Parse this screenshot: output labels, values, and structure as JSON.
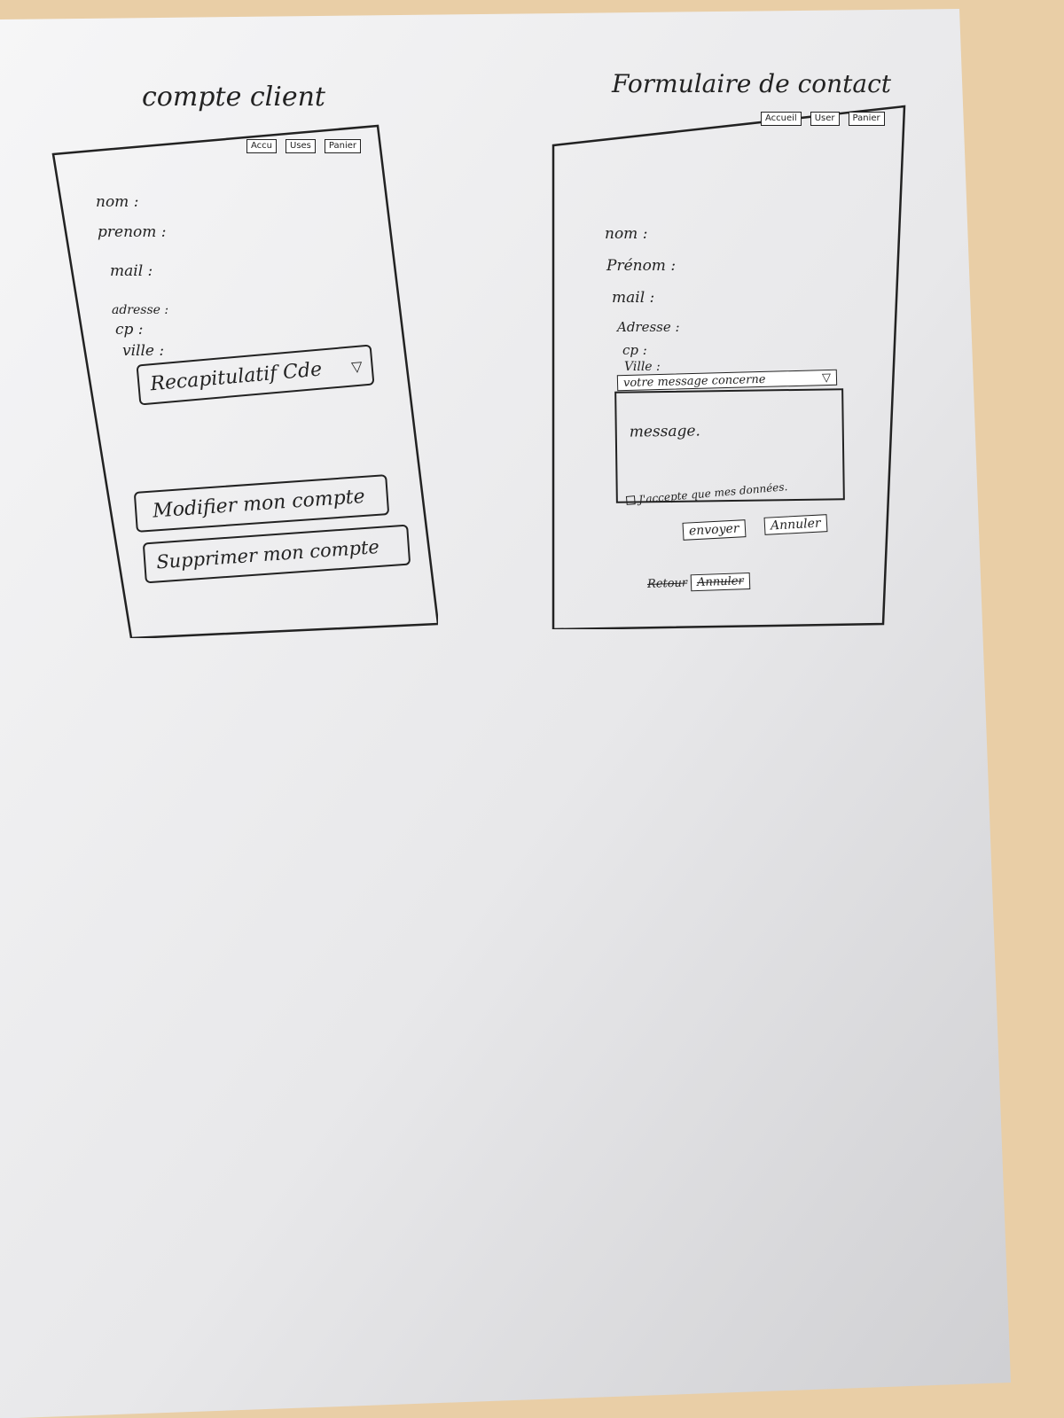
{
  "titles": {
    "left": "compte client",
    "right": "Formulaire de contact"
  },
  "account": {
    "nav": [
      "Accu",
      "Uses",
      "Panier"
    ],
    "fields": [
      "nom :",
      "prenom :",
      "mail :",
      "adresse :",
      "cp :",
      "ville :"
    ],
    "recap": {
      "label": "Recapitulatif Cde",
      "arrow": "▽"
    },
    "buttons": {
      "modify": "Modifier mon compte",
      "delete": "Supprimer mon compte"
    }
  },
  "contact": {
    "nav": [
      "Accueil",
      "User",
      "Panier"
    ],
    "fields": [
      "nom :",
      "Prénom :",
      "mail :",
      "Adresse :",
      "cp :",
      "Ville :"
    ],
    "subject_select": {
      "label": "votre message concerne",
      "arrow": "▽"
    },
    "message_placeholder": "message.",
    "consent": "J'accepte que mes données.",
    "buttons": {
      "send": "envoyer",
      "cancel": "Annuler"
    },
    "bottom": {
      "struck": "Retour",
      "button": "Annuler"
    }
  }
}
